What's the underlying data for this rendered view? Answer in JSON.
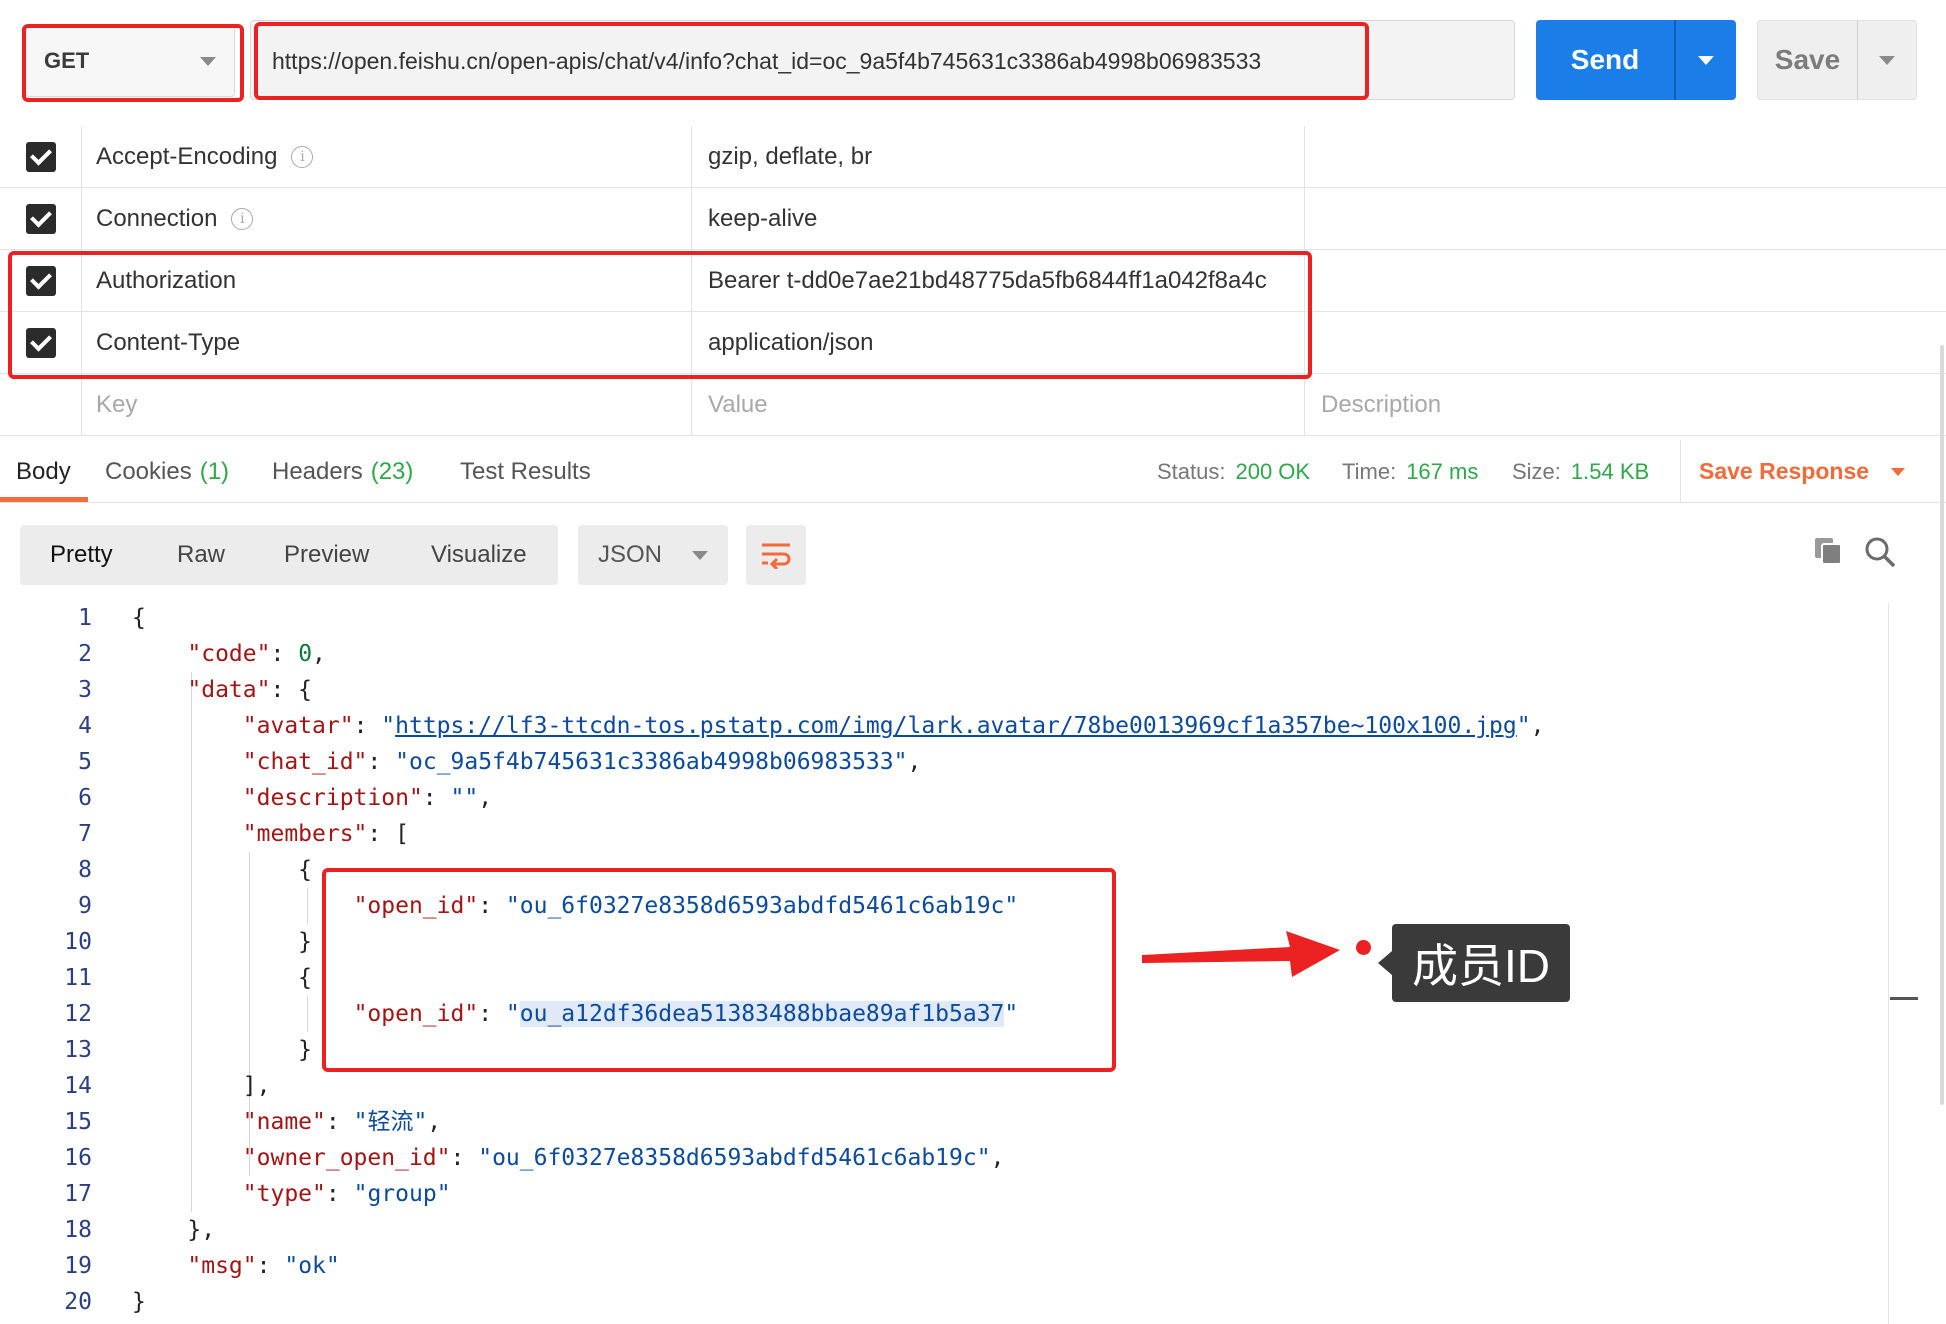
{
  "request": {
    "method": "GET",
    "url": "https://open.feishu.cn/open-apis/chat/v4/info?chat_id=oc_9a5f4b745631c3386ab4998b06983533",
    "send_label": "Send",
    "save_label": "Save"
  },
  "headers": [
    {
      "key": "Accept-Encoding",
      "value": "gzip, deflate, br",
      "info": true
    },
    {
      "key": "Connection",
      "value": "keep-alive",
      "info": true
    },
    {
      "key": "Authorization",
      "value": "Bearer t-dd0e7ae21bd48775da5fb6844ff1a042f8a4c",
      "info": false
    },
    {
      "key": "Content-Type",
      "value": "application/json",
      "info": false
    }
  ],
  "header_placeholders": {
    "key": "Key",
    "value": "Value",
    "description": "Description"
  },
  "response_tabs": {
    "body": "Body",
    "cookies": "Cookies",
    "cookies_count": "(1)",
    "headers": "Headers",
    "headers_count": "(23)",
    "tests": "Test Results"
  },
  "status": {
    "status_label": "Status:",
    "status_value": "200 OK",
    "time_label": "Time:",
    "time_value": "167 ms",
    "size_label": "Size:",
    "size_value": "1.54 KB",
    "save_response": "Save Response"
  },
  "view_modes": {
    "pretty": "Pretty",
    "raw": "Raw",
    "preview": "Preview",
    "visualize": "Visualize"
  },
  "format": "JSON",
  "json": {
    "code": "0",
    "avatar": "https://lf3-ttcdn-tos.pstatp.com/img/lark.avatar/78be0013969cf1a357be~100x100.jpg",
    "chat_id": "oc_9a5f4b745631c3386ab4998b06983533",
    "description": "",
    "member_1_open_id": "ou_6f0327e8358d6593abdfd5461c6ab19c",
    "member_2_open_id": "ou_a12df36dea51383488bbae89af1b5a37",
    "name": "轻流",
    "owner_open_id": "ou_6f0327e8358d6593abdfd5461c6ab19c",
    "type": "group",
    "msg": "ok"
  },
  "line_numbers": [
    "1",
    "2",
    "3",
    "4",
    "5",
    "6",
    "7",
    "8",
    "9",
    "10",
    "11",
    "12",
    "13",
    "14",
    "15",
    "16",
    "17",
    "18",
    "19",
    "20"
  ],
  "annotation": {
    "label": "成员ID"
  },
  "icons": [
    "info-icon",
    "checkbox-icon",
    "copy-icon",
    "search-icon",
    "wrap-lines-icon",
    "chevron-down-icon"
  ],
  "colors": {
    "send": "#1a7de8",
    "accent": "#f26b3a",
    "success": "#2fa84a",
    "annotation": "#ec2222"
  }
}
